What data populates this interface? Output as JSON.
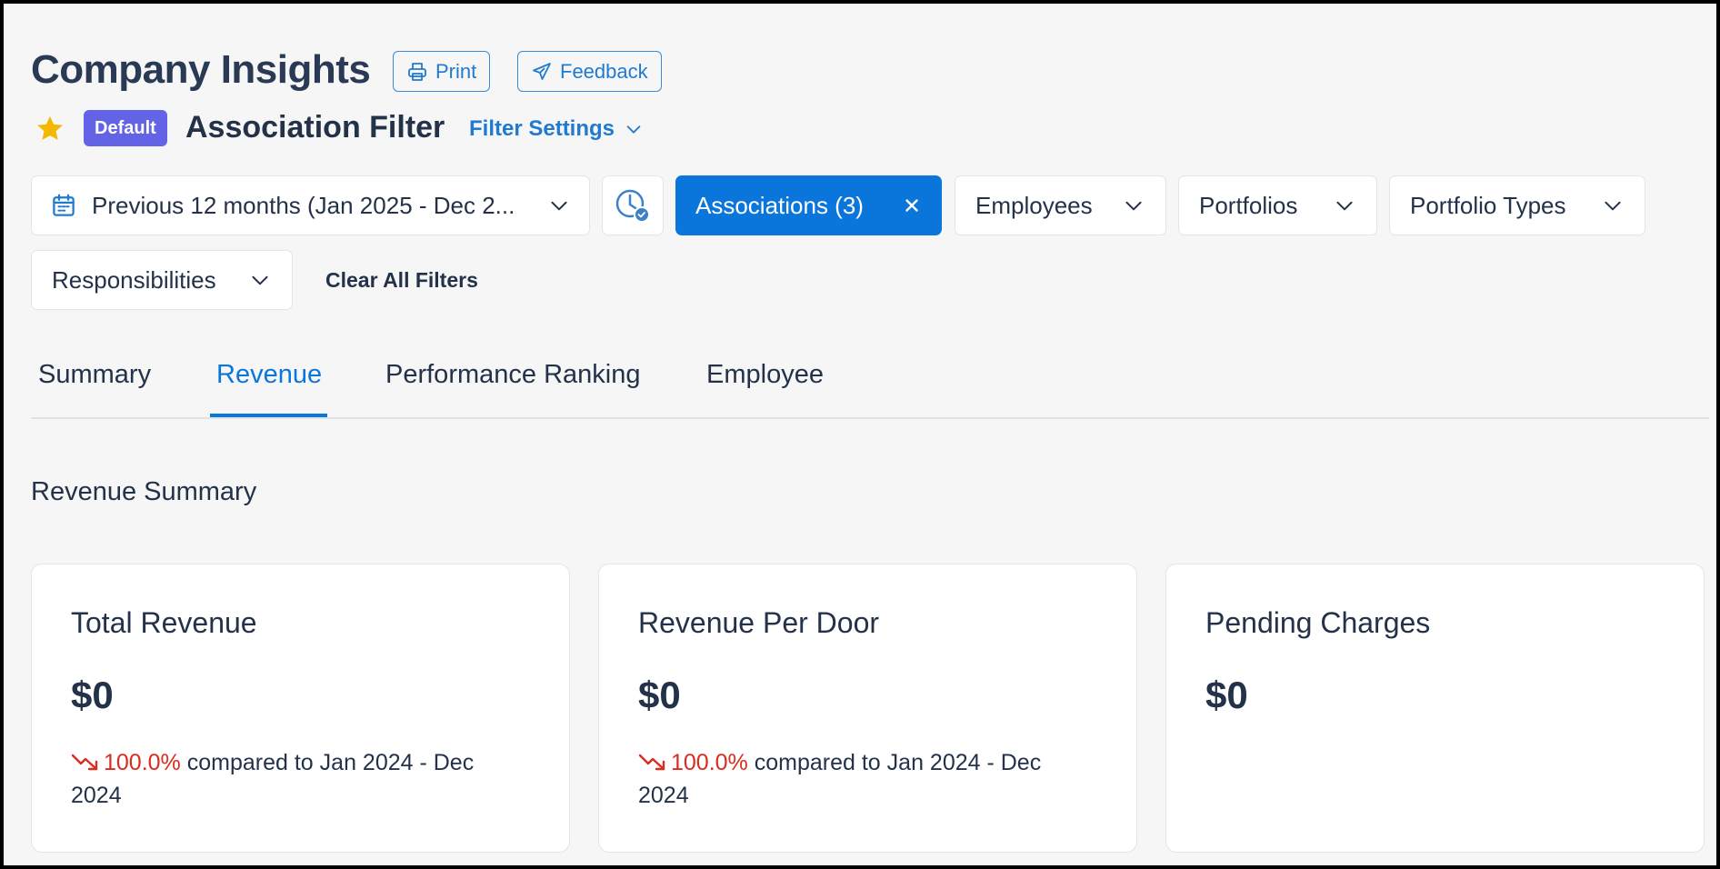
{
  "header": {
    "title": "Company Insights",
    "print_label": "Print",
    "feedback_label": "Feedback"
  },
  "filter": {
    "badge": "Default",
    "name": "Association Filter",
    "settings_label": "Filter Settings"
  },
  "filters": {
    "date_range": "Previous 12 months (Jan 2025 - Dec 2...",
    "associations": "Associations (3)",
    "employees": "Employees",
    "portfolios": "Portfolios",
    "portfolio_types": "Portfolio Types",
    "responsibilities": "Responsibilities",
    "clear_all": "Clear All Filters"
  },
  "tabs": [
    {
      "label": "Summary",
      "active": false
    },
    {
      "label": "Revenue",
      "active": true
    },
    {
      "label": "Performance Ranking",
      "active": false
    },
    {
      "label": "Employee",
      "active": false
    }
  ],
  "section": {
    "title": "Revenue Summary"
  },
  "cards": [
    {
      "title": "Total Revenue",
      "value": "$0",
      "change": "100.0%",
      "compare": "compared to Jan 2024 - Dec 2024"
    },
    {
      "title": "Revenue Per Door",
      "value": "$0",
      "change": "100.0%",
      "compare": "compared to Jan 2024 - Dec 2024"
    },
    {
      "title": "Pending Charges",
      "value": "$0"
    }
  ],
  "colors": {
    "accent": "#0a76db",
    "badge": "#6363e6",
    "negative": "#d92b1e",
    "star": "#f5b800"
  },
  "icons": [
    "printer-icon",
    "send-icon",
    "star-icon",
    "calendar-icon",
    "clock-check-icon",
    "chevron-down-icon",
    "close-icon",
    "trend-down-icon"
  ]
}
